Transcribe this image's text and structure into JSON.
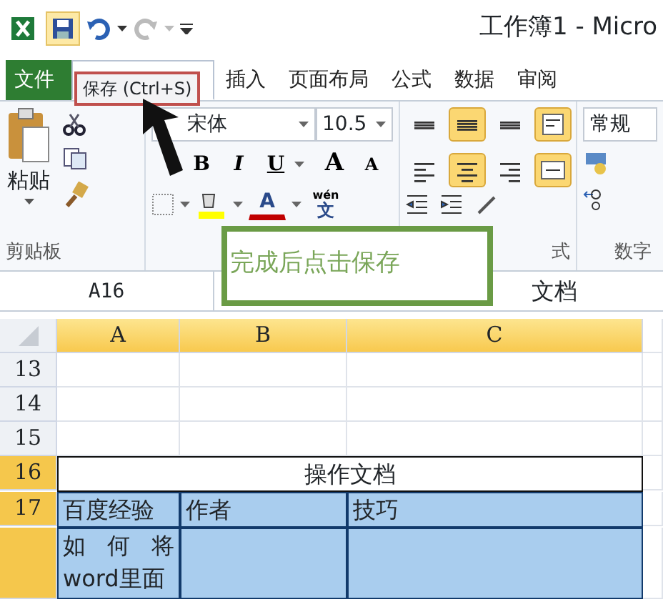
{
  "title_bar": {
    "title": "工作簿1 - Micro"
  },
  "tabs": [
    {
      "label": "文件",
      "kind": "file",
      "selected": false
    },
    {
      "kind": "tab",
      "selected": true
    },
    {
      "label": "插入",
      "kind": "tab",
      "selected": false
    },
    {
      "label": "页面布局",
      "kind": "tab",
      "selected": false
    },
    {
      "label": "公式",
      "kind": "tab",
      "selected": false
    },
    {
      "label": "数据",
      "kind": "tab",
      "selected": false
    },
    {
      "label": "审阅",
      "kind": "tab",
      "selected": false
    }
  ],
  "tooltip": {
    "text": "保存 (Ctrl+S)"
  },
  "ribbon": {
    "clipboard": {
      "paste_label": "粘贴",
      "group_label": "剪贴板"
    },
    "font": {
      "font_name": "宋体",
      "font_size": "10.5",
      "bold": "B",
      "italic": "I",
      "underline": "U",
      "grow": "A",
      "shrink": "A",
      "font_color": "A",
      "phonetic_top": "wén",
      "phonetic": "文"
    },
    "alignment": {
      "group_label": "式",
      "buttons": [
        {
          "kind": "top",
          "selected": false
        },
        {
          "kind": "middle",
          "selected": true
        },
        {
          "kind": "bottom",
          "selected": false
        },
        {
          "kind": "wrap",
          "selected": true
        },
        {
          "kind": "left",
          "selected": false
        },
        {
          "kind": "center",
          "selected": true
        },
        {
          "kind": "right",
          "selected": false
        },
        {
          "kind": "merge",
          "selected": true
        }
      ]
    },
    "number": {
      "format": "常规",
      "group_label": "数字"
    }
  },
  "callout": {
    "text": "完成后点击保存"
  },
  "formula_bar": {
    "name_box": "A16",
    "content": "文档"
  },
  "sheet": {
    "columns": [
      {
        "label": "A",
        "selected": true
      },
      {
        "label": "B",
        "selected": true
      },
      {
        "label": "C",
        "selected": true
      }
    ],
    "rows": [
      {
        "number": "13",
        "selected": false
      },
      {
        "number": "14",
        "selected": false
      },
      {
        "number": "15",
        "selected": false
      },
      {
        "number": "16",
        "selected": true
      },
      {
        "number": "17",
        "selected": true
      },
      {
        "selected": true
      }
    ],
    "title": "操作文档",
    "headers": [
      "百度经验",
      "作者",
      "技巧"
    ],
    "row_18": [
      "如 何 将 word里面"
    ]
  }
}
